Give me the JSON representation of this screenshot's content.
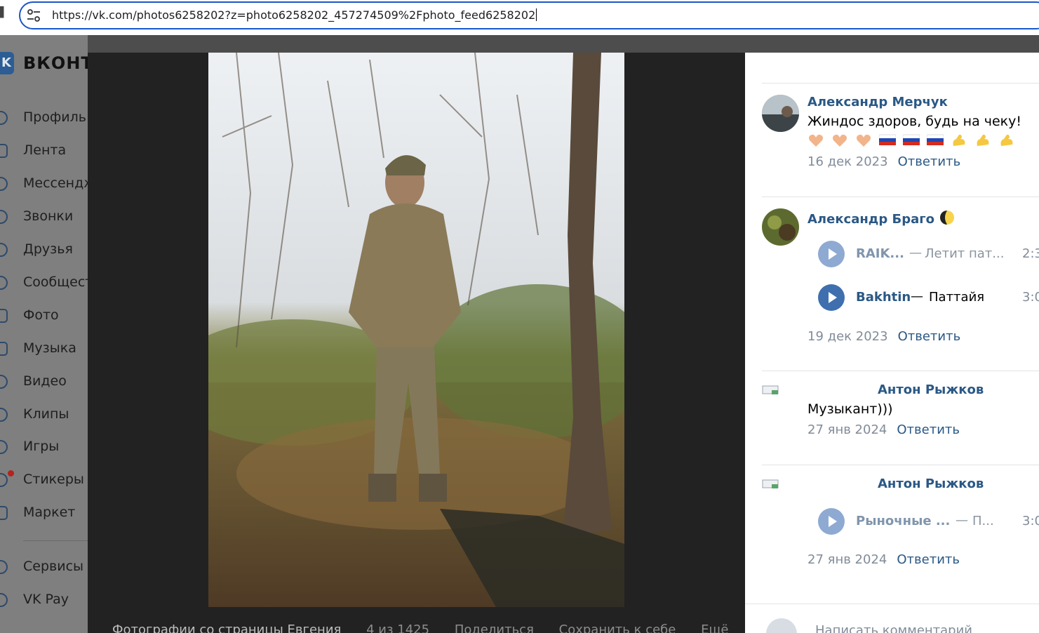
{
  "browser": {
    "url": "https://vk.com/photos6258202?z=photo6258202_457274509%2Fphoto_feed6258202"
  },
  "nav": {
    "brand": "ВКОНТ",
    "items": [
      {
        "label": "Профиль",
        "icon": "profile-icon"
      },
      {
        "label": "Лента",
        "icon": "feed-icon"
      },
      {
        "label": "Мессендж",
        "icon": "messenger-icon"
      },
      {
        "label": "Звонки",
        "icon": "calls-icon"
      },
      {
        "label": "Друзья",
        "icon": "friends-icon"
      },
      {
        "label": "Сообщест",
        "icon": "communities-icon"
      },
      {
        "label": "Фото",
        "icon": "photo-icon"
      },
      {
        "label": "Музыка",
        "icon": "music-icon"
      },
      {
        "label": "Видео",
        "icon": "video-icon"
      },
      {
        "label": "Клипы",
        "icon": "clips-icon"
      },
      {
        "label": "Игры",
        "icon": "games-icon"
      },
      {
        "label": "Стикеры",
        "icon": "stickers-icon"
      },
      {
        "label": "Маркет",
        "icon": "market-icon"
      },
      {
        "label": "Сервисы",
        "icon": "services-icon"
      },
      {
        "label": "VK Pay",
        "icon": "vkpay-icon"
      }
    ]
  },
  "viewer": {
    "album": "Фотографии со страницы Евгения",
    "counter": "4 из 1425",
    "share": "Поделиться",
    "save": "Сохранить к себе",
    "more": "Ещё"
  },
  "comments": [
    {
      "author": "Александр Мерчук",
      "text": "Жиндос здоров, будь на чеку!",
      "date": "16 дек 2023",
      "reply": "Ответить"
    },
    {
      "author": "Александр Браго",
      "tracks": [
        {
          "artist": "RAIK...",
          "title": "Летит пат...",
          "duration": "2:3"
        },
        {
          "artist": "Bakhtin",
          "title": "Паттайя",
          "duration": "3:0"
        }
      ],
      "date": "19 дек 2023",
      "reply": "Ответить"
    },
    {
      "author": "Антон Рыжков",
      "text": "Музыкант)))",
      "date": "27 янв 2024",
      "reply": "Ответить"
    },
    {
      "author": "Антон Рыжков",
      "tracks": [
        {
          "artist": "Рыночные ...",
          "title": "П...",
          "duration": "3:0"
        }
      ],
      "date": "27 янв 2024",
      "reply": "Ответить"
    }
  ],
  "composer": {
    "placeholder": "Написать комментарий"
  },
  "colors": {
    "link": "#2a5885",
    "meta": "#818c99",
    "viewer_bg": "#222222",
    "address_border": "#1a56c7"
  }
}
